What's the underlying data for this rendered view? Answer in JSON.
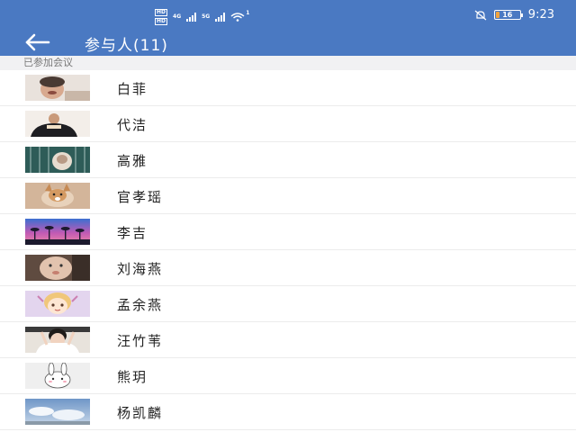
{
  "status_bar": {
    "carrier_tags": [
      "HD",
      "HD"
    ],
    "network_a": "4G",
    "network_b": "5G",
    "wifi_superscript": "1",
    "battery_level": "16",
    "battery_fraction": 0.16,
    "time": "9:23"
  },
  "header": {
    "title": "参与人(11)",
    "back_icon": "arrow-left-icon"
  },
  "section": {
    "label": "已参加会议"
  },
  "participants": [
    {
      "name": "白菲",
      "avatar": "avatar-photo-baby-face"
    },
    {
      "name": "代洁",
      "avatar": "avatar-photo-person-dark"
    },
    {
      "name": "高雅",
      "avatar": "avatar-photo-cat"
    },
    {
      "name": "官孝瑶",
      "avatar": "avatar-photo-dog"
    },
    {
      "name": "李吉",
      "avatar": "avatar-photo-palm-sunset"
    },
    {
      "name": "刘海燕",
      "avatar": "avatar-photo-baby"
    },
    {
      "name": "孟余燕",
      "avatar": "avatar-cartoon-girl"
    },
    {
      "name": "汪竹苇",
      "avatar": "avatar-photo-child"
    },
    {
      "name": "熊玥",
      "avatar": "avatar-cartoon-rabbit"
    },
    {
      "name": "杨凯麟",
      "avatar": "avatar-photo-sky"
    }
  ],
  "colors": {
    "header_bg": "#4a79c2",
    "section_bg": "#f1f1f3",
    "battery": "#f0a33c"
  }
}
